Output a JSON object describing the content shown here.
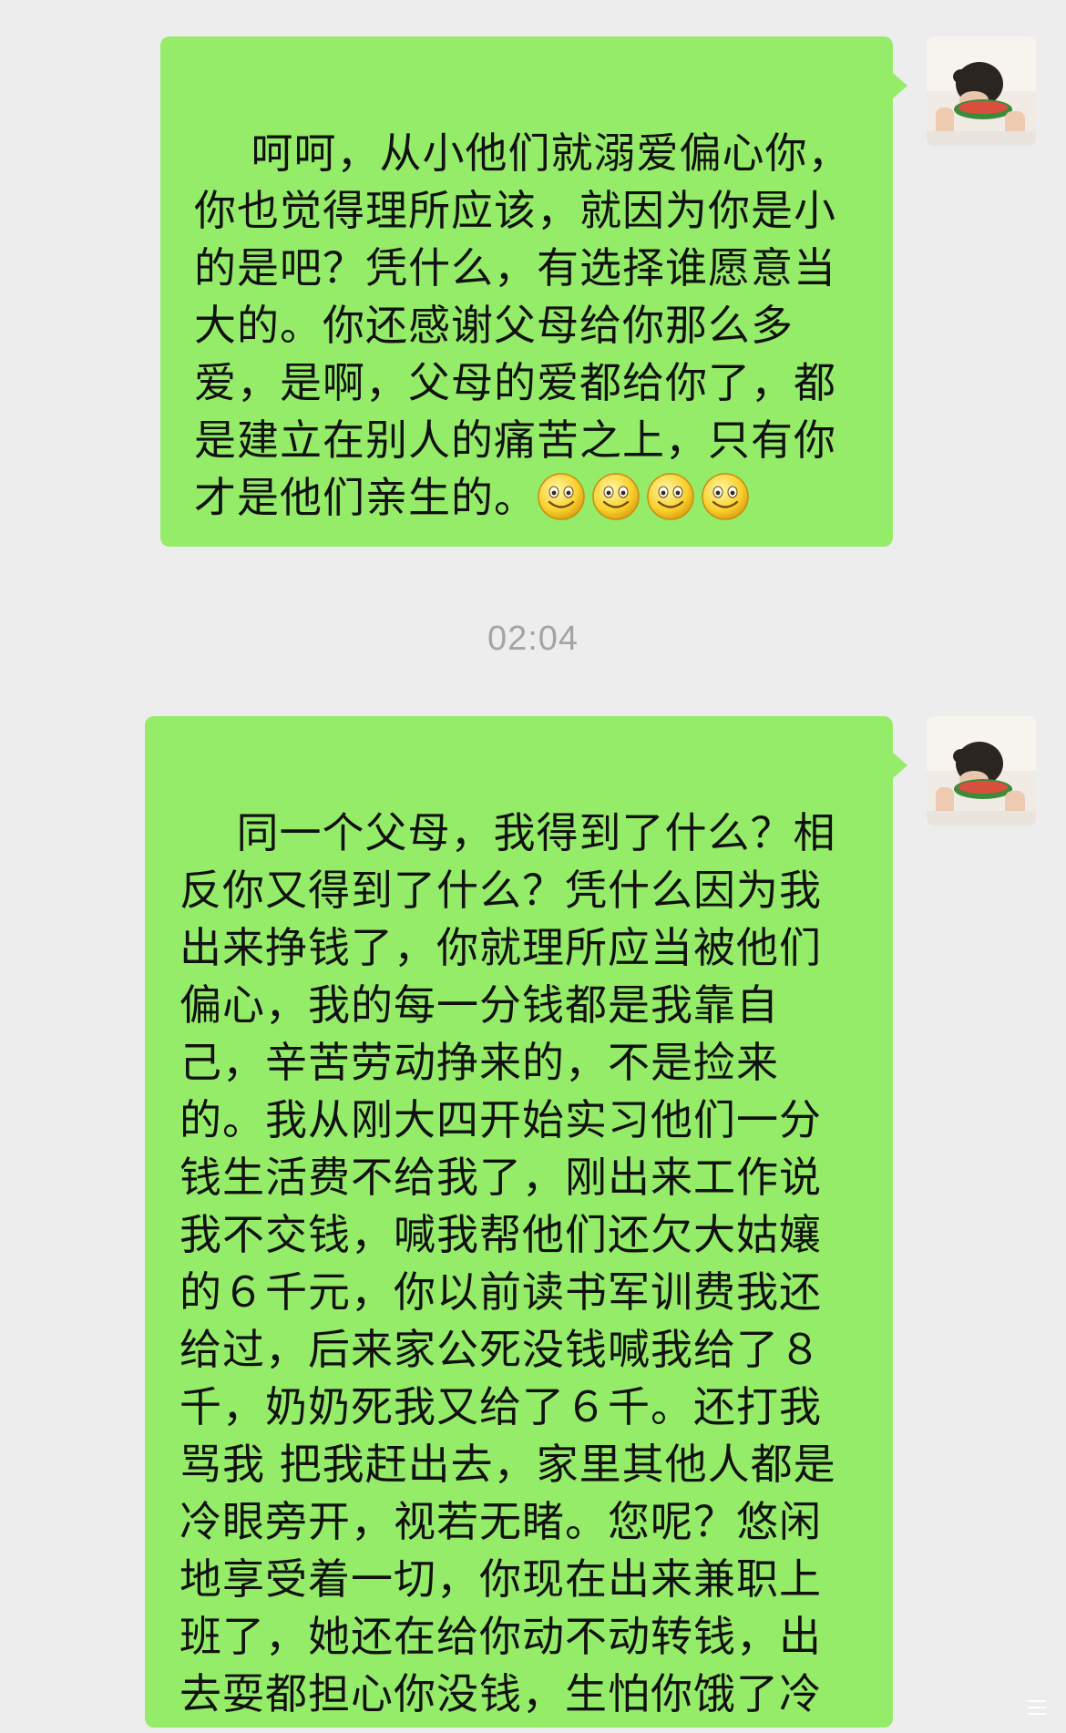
{
  "messages": [
    {
      "text": "呵呵，从小他们就溺爱偏心你，你也觉得理所应该，就因为你是小的是吧？凭什么，有选择谁愿意当大的。你还感谢父母给你那么多爱，是啊，父母的爱都给你了，都是建立在别人的痛苦之上，只有你才是他们亲生的。",
      "emoji_count": 4,
      "emoji_icon": "smiley-face-icon"
    },
    {
      "text": "同一个父母，我得到了什么？相反你又得到了什么？凭什么因为我出来挣钱了，你就理所应当被他们偏心，我的每一分钱都是我靠自己，辛苦劳动挣来的，不是捡来的。我从刚大四开始实习他们一分钱生活费不给我了，刚出来工作说我不交钱，喊我帮他们还欠大姑孃的６千元，你以前读书军训费我还给过，后来家公死没钱喊我给了８千，奶奶死我又给了６千。还打我骂我 把我赶出去，家里其他人都是冷眼旁开，视若无睹。您呢？悠闲地享受着一切，你现在出来兼职上班了，她还在给你动不动转钱，出去耍都担心你没钱，生怕你饿了冷了。"
    }
  ],
  "timestamp": "02:04",
  "colors": {
    "background": "#ededed",
    "bubble": "#95ec69",
    "timestamp": "#a4a4a4"
  },
  "icons": {
    "avatar": "avatar-photo",
    "corner": "menu-lines-icon"
  }
}
